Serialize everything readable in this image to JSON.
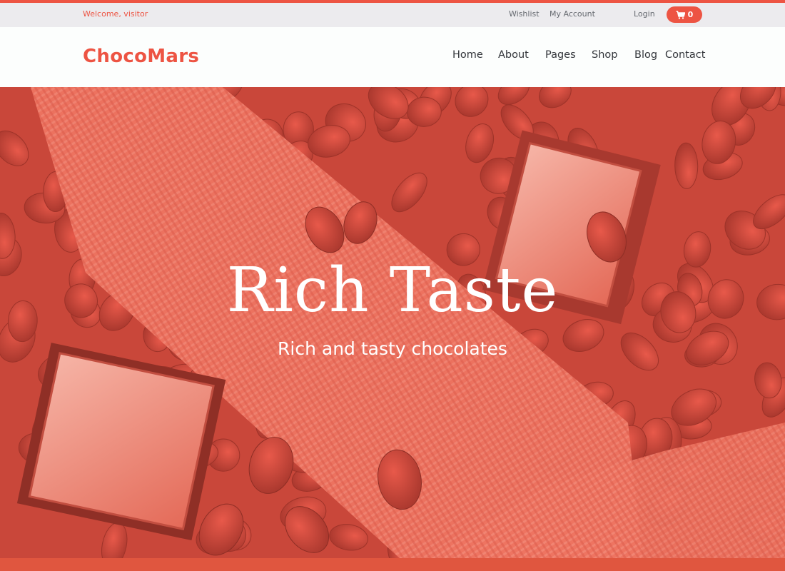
{
  "topbar": {
    "welcome": "Welcome, visitor",
    "links": {
      "wishlist": "Wishlist",
      "account": "My Account",
      "login": "Login"
    },
    "cart": {
      "icon": "cart-icon",
      "count": "0"
    }
  },
  "header": {
    "logo": "ChocoMars",
    "nav": {
      "home": "Home",
      "about": "About",
      "pages": "Pages",
      "shop": "Shop",
      "blog": "Blog",
      "contact": "Contact"
    }
  },
  "hero": {
    "title": "Rich Taste",
    "subtitle": "Rich and tasty chocolates"
  },
  "colors": {
    "accent": "#ed5443",
    "hero_overlay": "#d24a3c",
    "topbar_bg": "#ecebee",
    "nav_text": "#33363b"
  }
}
